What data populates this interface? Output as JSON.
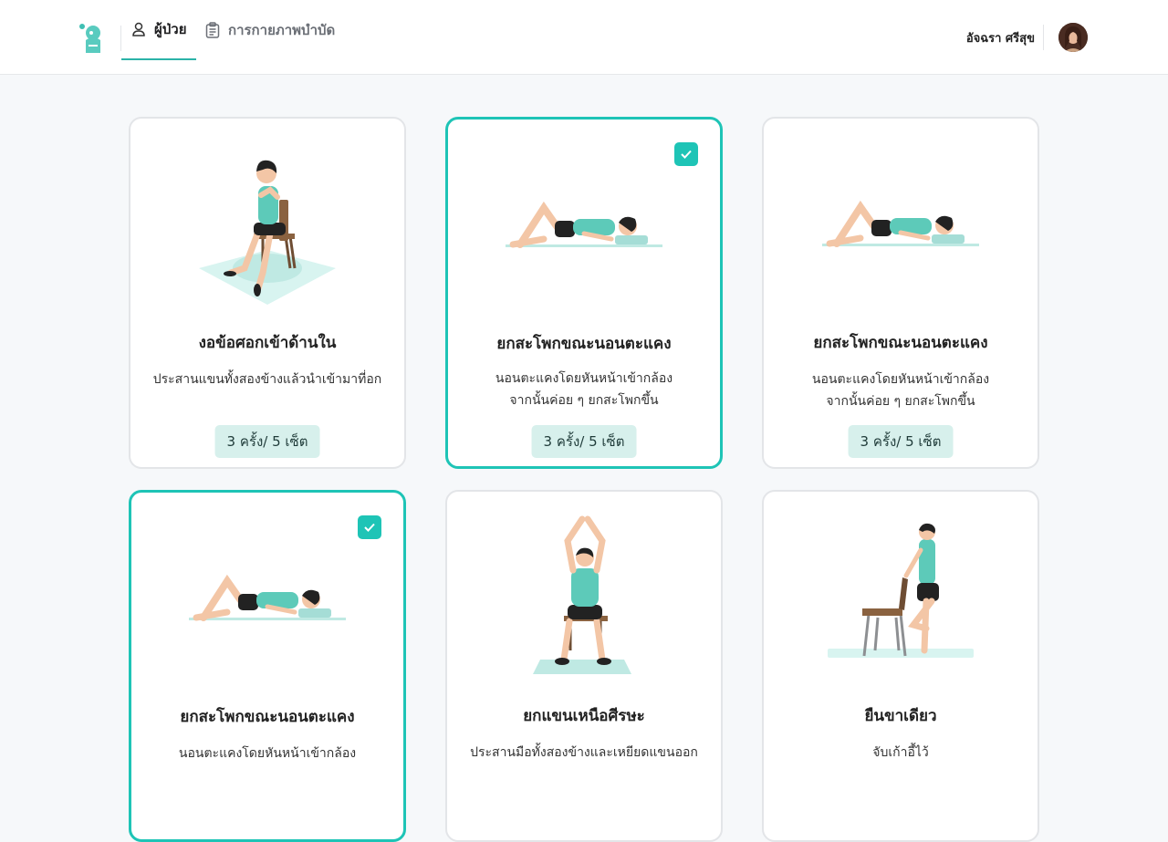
{
  "header": {
    "nav": [
      {
        "label": "ผู้ป่วย",
        "icon": "user-icon",
        "active": true
      },
      {
        "label": "การกายภาพบำบัด",
        "icon": "clipboard-icon",
        "active": false
      }
    ],
    "user_name": "อัจฉรา ศรีสุข"
  },
  "colors": {
    "accent": "#1ec4b6",
    "badge_bg": "#d7f0ec"
  },
  "cards": [
    {
      "title": "งอข้อศอกเข้าด้านใน",
      "desc1": "ประสานแขนทั้งสองข้างแล้วนำเข้ามาที่อก",
      "desc2": "",
      "badge": "3 ครั้ง/ 5 เซ็ต",
      "selected": false,
      "illustration": "sitting-chair-arms-crossed"
    },
    {
      "title": "ยกสะโพกขณะนอนตะแคง",
      "desc1": "นอนตะแคงโดยหันหน้าเข้ากล้อง",
      "desc2": "จากนั้นค่อย ๆ ยกสะโพกขึ้น",
      "badge": "3 ครั้ง/ 5 เซ็ต",
      "selected": true,
      "illustration": "lying-hip-raise"
    },
    {
      "title": "ยกสะโพกขณะนอนตะแคง",
      "desc1": "นอนตะแคงโดยหันหน้าเข้ากล้อง",
      "desc2": "จากนั้นค่อย ๆ ยกสะโพกขึ้น",
      "badge": "3 ครั้ง/ 5 เซ็ต",
      "selected": false,
      "illustration": "lying-hip-raise"
    },
    {
      "title": "ยกสะโพกขณะนอนตะแคง",
      "desc1": "นอนตะแคงโดยหันหน้าเข้ากล้อง",
      "desc2": "",
      "badge": "",
      "selected": true,
      "illustration": "lying-hip-raise"
    },
    {
      "title": "ยกแขนเหนือศีรษะ",
      "desc1": "ประสานมือทั้งสองข้างและเหยียดแขนออก",
      "desc2": "",
      "badge": "",
      "selected": false,
      "illustration": "seated-arms-overhead"
    },
    {
      "title": "ยืนขาเดียว",
      "desc1": "จับเก้าอี้ไว้",
      "desc2": "",
      "badge": "",
      "selected": false,
      "illustration": "standing-one-leg-chair"
    }
  ]
}
